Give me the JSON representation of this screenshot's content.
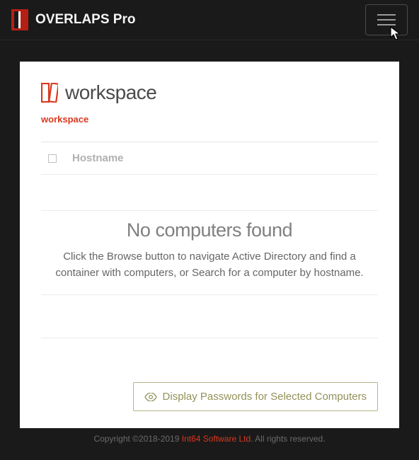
{
  "header": {
    "brand": "OVERLAPS Pro"
  },
  "page": {
    "title": "workspace",
    "breadcrumb": "workspace"
  },
  "table": {
    "column_host": "Hostname"
  },
  "empty": {
    "title": "No computers found",
    "subtitle": "Click the Browse button to navigate Active Directory and find a container with computers, or Search for a computer by hostname."
  },
  "actions": {
    "display_passwords": "Display Passwords for Selected Computers"
  },
  "footer": {
    "prefix": "Copyright ©2018-2019 ",
    "company": "Int64 Software Ltd",
    "suffix": ". All rights reserved."
  }
}
